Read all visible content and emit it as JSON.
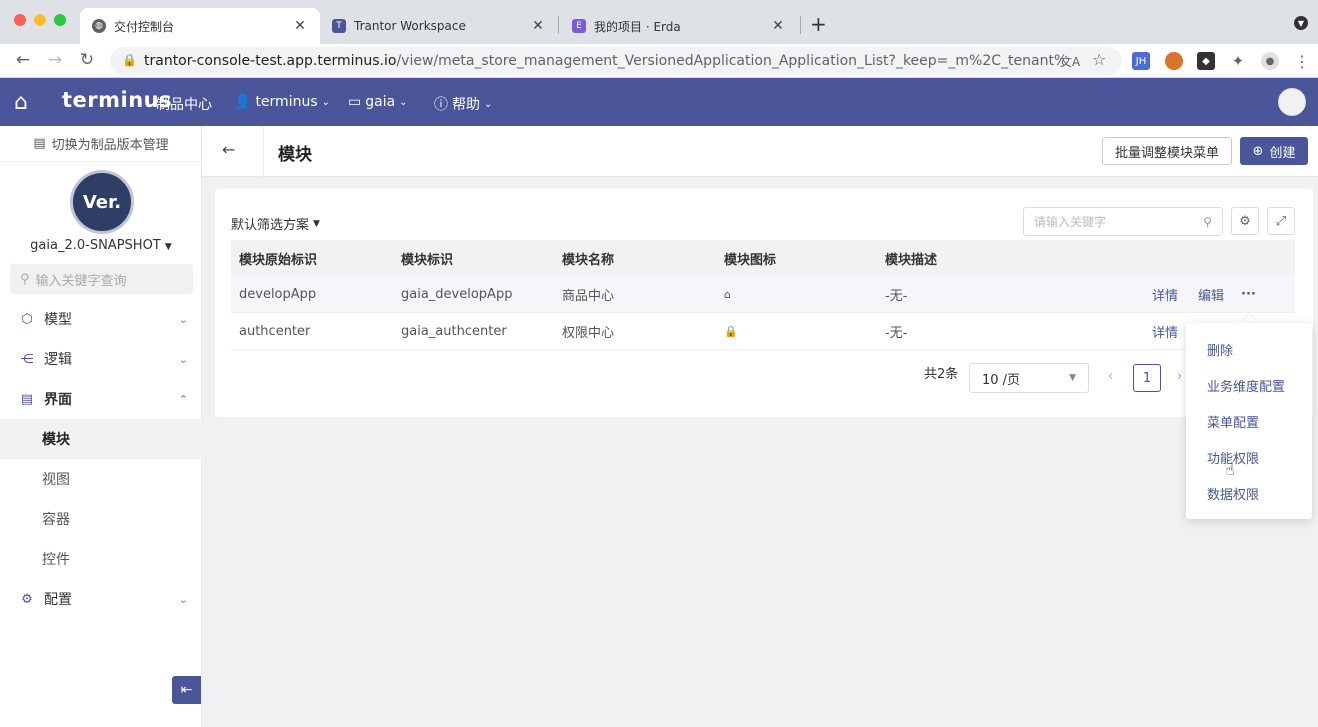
{
  "browser": {
    "tabs": [
      {
        "title": "交付控制台",
        "icon": "globe-icon"
      },
      {
        "title": "Trantor Workspace",
        "icon": "T"
      },
      {
        "title": "我的项目 · Erda",
        "icon": "E"
      }
    ],
    "url_host": "trantor-console-test.app.terminus.io",
    "url_path": "/view/meta_store_management_VersionedApplication_Application_List?_keep=_m%2C_tenant%2C_...",
    "ext_jh": "JH"
  },
  "header": {
    "logo": "terminus",
    "product_center": "制品中心",
    "org": "terminus",
    "project": "gaia",
    "help": "帮助"
  },
  "sidebar": {
    "switch_label": "切换为制品版本管理",
    "logo_text": "Ver.",
    "project_name": "gaia_2.0-SNAPSHOT",
    "search_placeholder": "输入关键字查询",
    "menu": [
      {
        "label": "模型",
        "icon": "model-icon"
      },
      {
        "label": "逻辑",
        "icon": "logic-icon"
      },
      {
        "label": "界面",
        "icon": "ui-icon"
      },
      {
        "label": "配置",
        "icon": "config-icon"
      }
    ],
    "sub_items": [
      "模块",
      "视图",
      "容器",
      "控件"
    ]
  },
  "page": {
    "title": "模块",
    "batch_button": "批量调整模块菜单",
    "create_button": "创建",
    "filter_label": "默认筛选方案",
    "search_placeholder": "请输入关键字",
    "columns": [
      "模块原始标识",
      "模块标识",
      "模块名称",
      "模块图标",
      "模块描述"
    ],
    "rows": [
      {
        "orig": "developApp",
        "key": "gaia_developApp",
        "name": "商品中心",
        "icon": "house-icon",
        "desc": "-无-"
      },
      {
        "orig": "authcenter",
        "key": "gaia_authcenter",
        "name": "权限中心",
        "icon": "lock-icon",
        "desc": "-无-"
      }
    ],
    "row_actions": {
      "detail": "详情",
      "edit": "编辑",
      "more": "···"
    },
    "pagination": {
      "total": "共2条",
      "page_size": "10 /页",
      "current": "1"
    },
    "dropdown": [
      "删除",
      "业务维度配置",
      "菜单配置",
      "功能权限",
      "数据权限"
    ]
  },
  "colors": {
    "brand": "#4a5699",
    "header_bg": "#4a5699"
  }
}
